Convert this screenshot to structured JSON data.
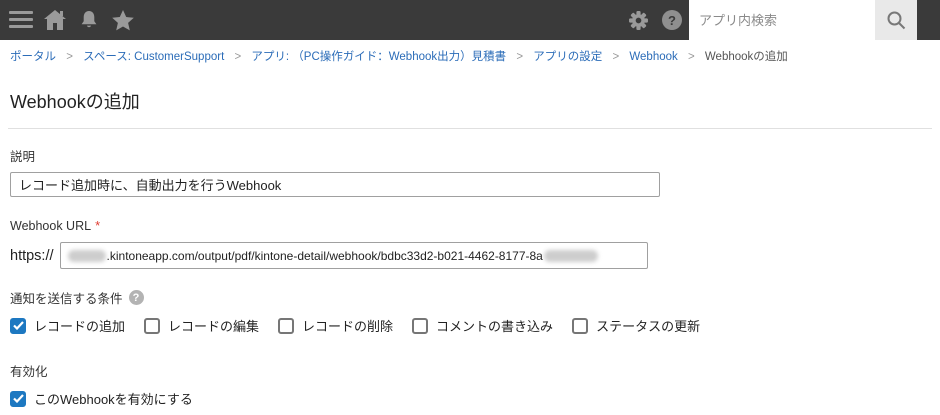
{
  "topbar": {
    "search": {
      "placeholder": "アプリ内検索"
    }
  },
  "breadcrumb": {
    "separator": ">",
    "items": [
      {
        "label": "ポータル"
      },
      {
        "label": "スペース: CustomerSupport"
      },
      {
        "label": "アプリ: （PC操作ガイド：Webhook出力）見積書"
      },
      {
        "label": "アプリの設定"
      },
      {
        "label": "Webhook"
      },
      {
        "label": "Webhookの追加"
      }
    ]
  },
  "page": {
    "title": "Webhookの追加"
  },
  "form": {
    "description": {
      "label": "説明",
      "value": "レコード追加時に、自動出力を行うWebhook"
    },
    "webhook_url": {
      "label": "Webhook URL",
      "required_mark": "*",
      "scheme": "https://",
      "visible_value": ".kintoneapp.com/output/pdf/kintone-detail/webhook/bdbc33d2-b021-4462-8177-8a"
    },
    "conditions": {
      "label": "通知を送信する条件",
      "help_mark": "?",
      "options": [
        {
          "label": "レコードの追加",
          "checked": true
        },
        {
          "label": "レコードの編集",
          "checked": false
        },
        {
          "label": "レコードの削除",
          "checked": false
        },
        {
          "label": "コメントの書き込み",
          "checked": false
        },
        {
          "label": "ステータスの更新",
          "checked": false
        }
      ]
    },
    "enable": {
      "label": "有効化",
      "option": {
        "label": "このWebhookを有効にする",
        "checked": true
      }
    }
  },
  "colors": {
    "topbar_bg": "#3a3a3a",
    "accent_blue": "#1d78c1",
    "link_blue": "#2b6cb8",
    "required_red": "#e03c31"
  }
}
